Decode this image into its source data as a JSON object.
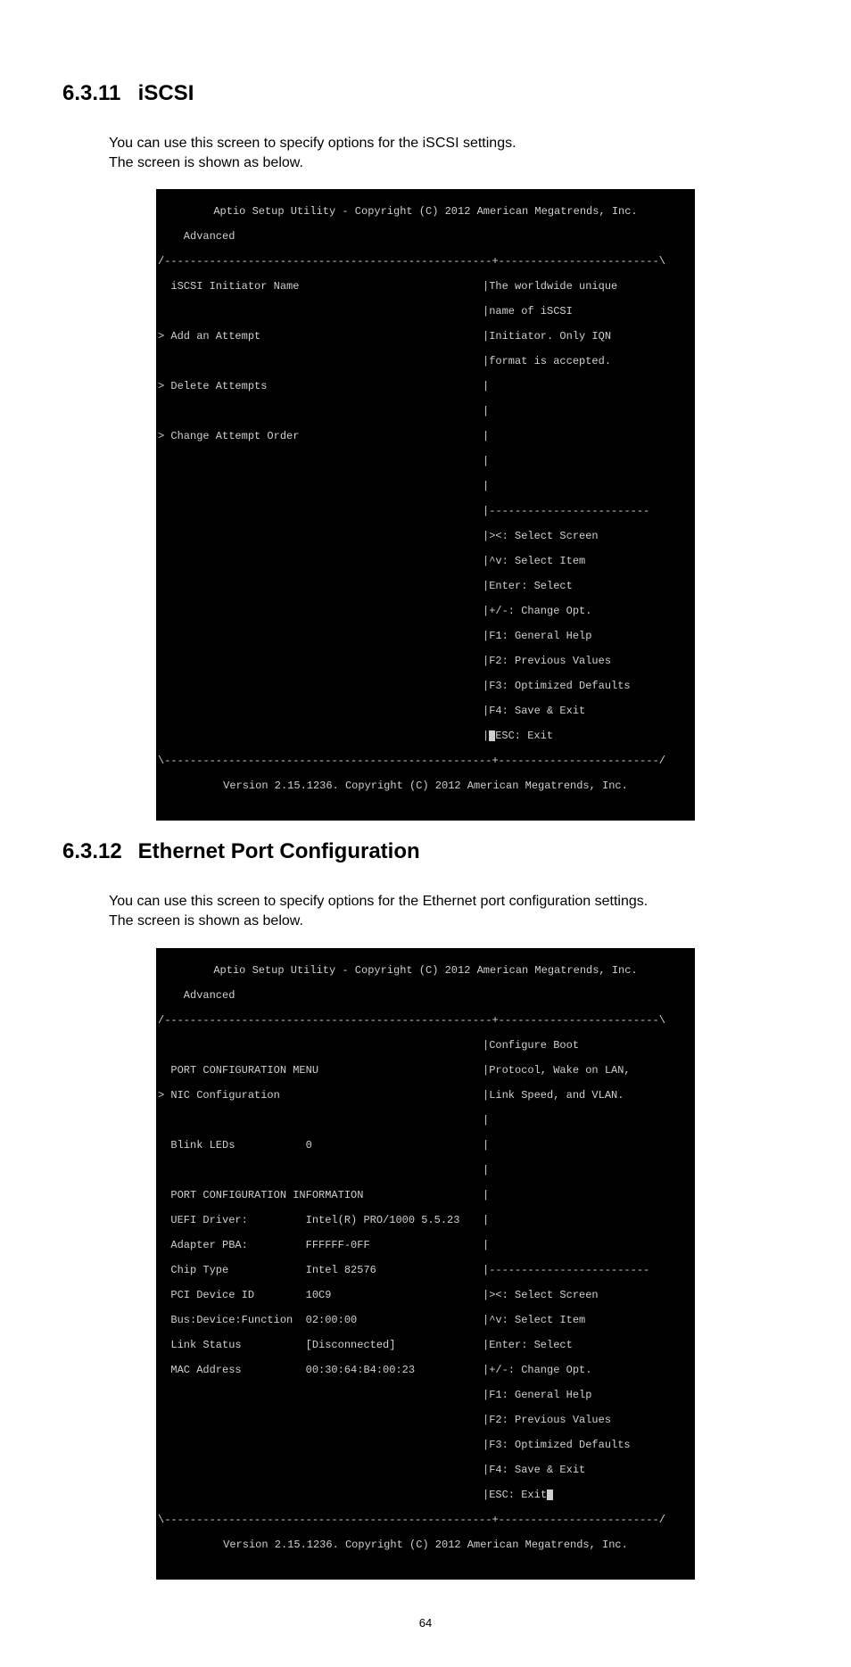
{
  "page_number": "64",
  "sec1": {
    "number": "6.3.11",
    "title": "iSCSI",
    "para1": "You can use this screen to specify options for the iSCSI settings.",
    "para2": "The screen is shown as below.",
    "term": {
      "header": "Aptio Setup Utility - Copyright (C) 2012 American Megatrends, Inc.",
      "tab": "    Advanced",
      "left_items": [
        "  iSCSI Initiator Name",
        "",
        "> Add an Attempt",
        "",
        "> Delete Attempts",
        "",
        "> Change Attempt Order",
        "",
        "",
        "",
        "",
        "",
        "",
        "",
        "",
        "",
        "",
        ""
      ],
      "right_help": [
        "|The worldwide unique",
        "|name of iSCSI",
        "|Initiator. Only IQN",
        "|format is accepted.",
        "|",
        "|",
        "|",
        "|",
        "|",
        "|-------------------------",
        "|><: Select Screen",
        "|^v: Select Item",
        "|Enter: Select",
        "|+/-: Change Opt.",
        "|F1: General Help",
        "|F2: Previous Values",
        "|F3: Optimized Defaults",
        "|F4: Save & Exit"
      ],
      "esc_left": "",
      "esc_right": "|ESC: Exit",
      "footer": "Version 2.15.1236. Copyright (C) 2012 American Megatrends, Inc."
    }
  },
  "sec2": {
    "number": "6.3.12",
    "title": "Ethernet Port Configuration",
    "para1": "You can use this screen to specify options for the Ethernet port configuration settings.",
    "para2": "The screen is shown as below.",
    "term": {
      "header": "Aptio Setup Utility - Copyright (C) 2012 American Megatrends, Inc.",
      "tab": "    Advanced",
      "left_items": [
        "",
        "  PORT CONFIGURATION MENU",
        "> NIC Configuration",
        "",
        "  Blink LEDs           0",
        "",
        "  PORT CONFIGURATION INFORMATION",
        "  UEFI Driver:         Intel(R) PRO/1000 5.5.23",
        "  Adapter PBA:         FFFFFF-0FF",
        "  Chip Type            Intel 82576",
        "  PCI Device ID        10C9",
        "  Bus:Device:Function  02:00:00",
        "  Link Status          [Disconnected]",
        "  MAC Address          00:30:64:B4:00:23",
        "",
        "",
        "",
        ""
      ],
      "right_help": [
        "|Configure Boot",
        "|Protocol, Wake on LAN,",
        "|Link Speed, and VLAN.",
        "|",
        "|",
        "|",
        "|",
        "|",
        "|",
        "|-------------------------",
        "|><: Select Screen",
        "|^v: Select Item",
        "|Enter: Select",
        "|+/-: Change Opt.",
        "|F1: General Help",
        "|F2: Previous Values",
        "|F3: Optimized Defaults",
        "|F4: Save & Exit"
      ],
      "esc_left": "",
      "esc_right": "|ESC: Exit",
      "footer": "Version 2.15.1236. Copyright (C) 2012 American Megatrends, Inc."
    }
  }
}
